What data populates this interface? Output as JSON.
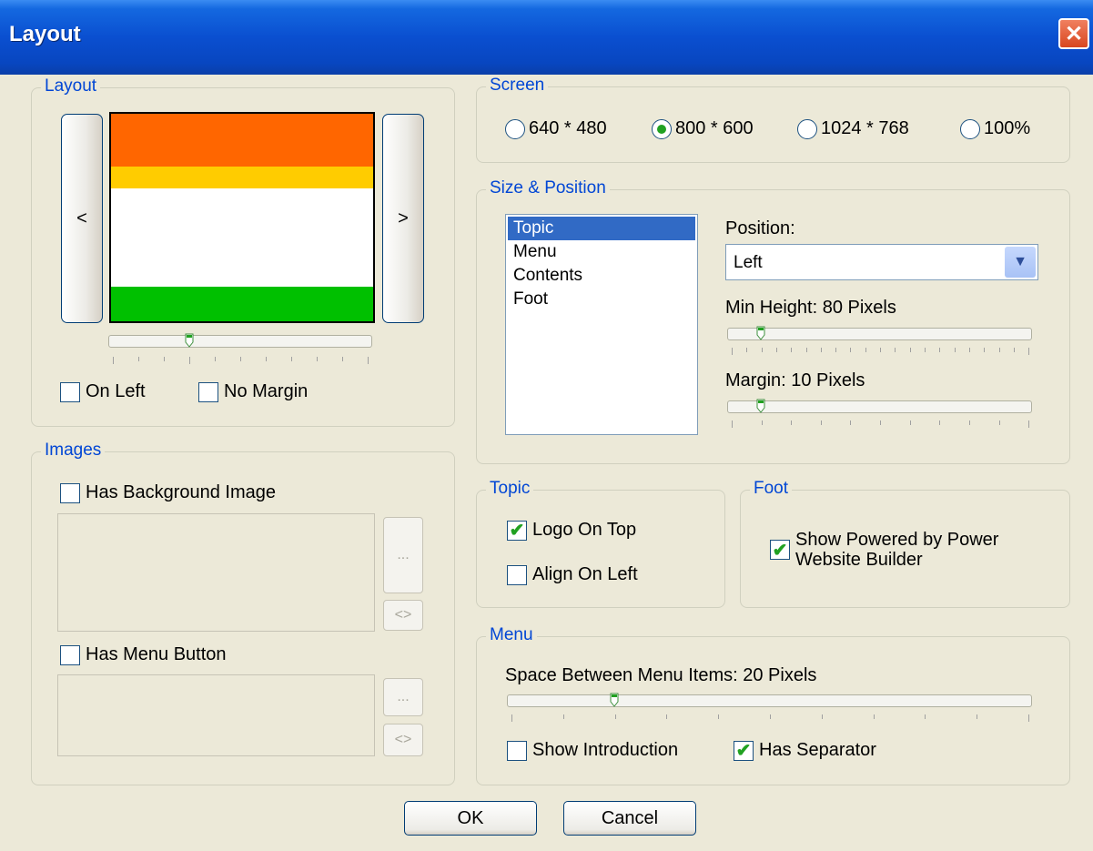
{
  "window": {
    "title": "Layout"
  },
  "layout_group": {
    "legend": "Layout",
    "prev_label": "<",
    "next_label": ">",
    "preview_colors": [
      "#ff6600",
      "#ffcc00",
      "#ffffff",
      "#00c000"
    ],
    "on_left": {
      "label": "On Left",
      "checked": false
    },
    "no_margin": {
      "label": "No Margin",
      "checked": false
    }
  },
  "screen": {
    "legend": "Screen",
    "options": [
      {
        "label": "640 * 480",
        "selected": false
      },
      {
        "label": "800 * 600",
        "selected": true
      },
      {
        "label": "1024 * 768",
        "selected": false
      },
      {
        "label": "100%",
        "selected": false
      }
    ]
  },
  "size_position": {
    "legend": "Size & Position",
    "items": [
      "Topic",
      "Menu",
      "Contents",
      "Foot"
    ],
    "selected_item": "Topic",
    "position_label": "Position:",
    "position_value": "Left",
    "min_height_label": "Min Height: 80 Pixels",
    "margin_label": "Margin: 10 Pixels"
  },
  "images": {
    "legend": "Images",
    "has_background": {
      "label": "Has Background Image",
      "checked": false
    },
    "has_menu_button": {
      "label": "Has Menu Button",
      "checked": false
    },
    "browse_label": "...",
    "clear_label": "<>"
  },
  "topic": {
    "legend": "Topic",
    "logo_on_top": {
      "label": "Logo On Top",
      "checked": true
    },
    "align_on_left": {
      "label": "Align On Left",
      "checked": false
    }
  },
  "foot": {
    "legend": "Foot",
    "show_powered": {
      "label_line1": "Show Powered by Power",
      "label_line2": "Website Builder",
      "checked": true
    }
  },
  "menu": {
    "legend": "Menu",
    "space_label": "Space Between Menu Items: 20 Pixels",
    "show_intro": {
      "label": "Show Introduction",
      "checked": false
    },
    "has_separator": {
      "label": "Has Separator",
      "checked": true
    }
  },
  "buttons": {
    "ok": "OK",
    "cancel": "Cancel"
  }
}
